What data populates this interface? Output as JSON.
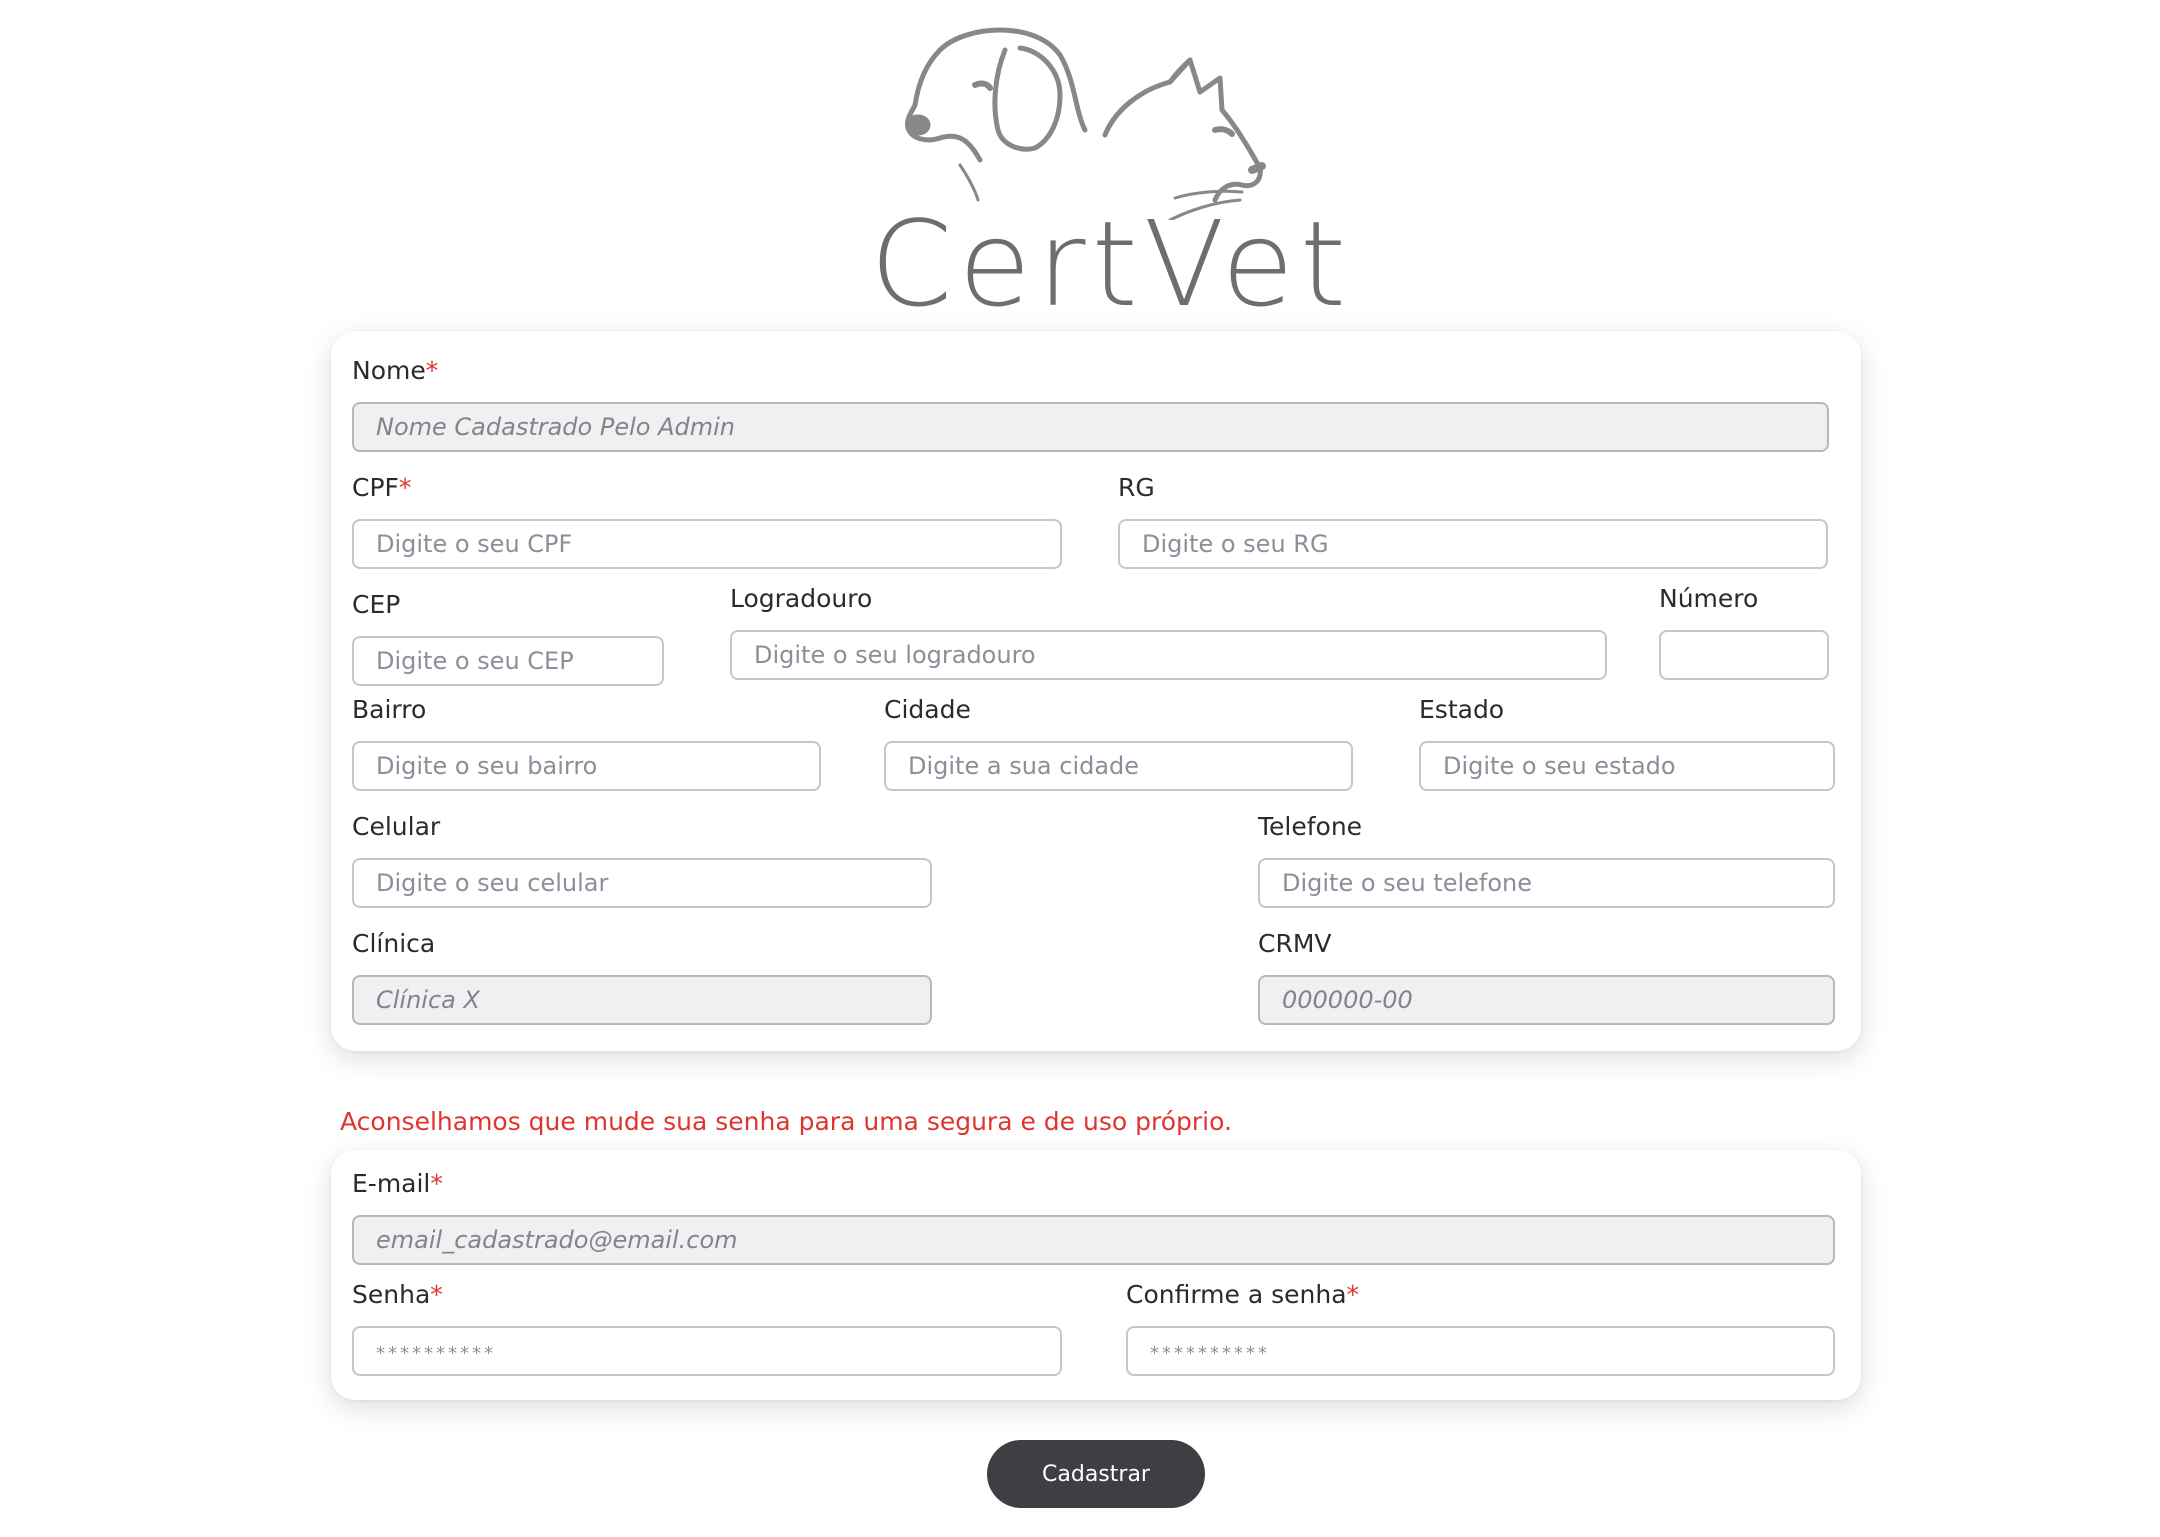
{
  "brand": {
    "name": "CertVet",
    "logo_icon": "dog-and-cat-logo-icon"
  },
  "profile": {
    "nome": {
      "label": "Nome",
      "required": "*",
      "placeholder": "Nome Cadastrado Pelo Admin"
    },
    "cpf": {
      "label": "CPF",
      "required": "*",
      "placeholder": "Digite o seu CPF"
    },
    "rg": {
      "label": "RG",
      "placeholder": "Digite o seu RG"
    },
    "cep": {
      "label": "CEP",
      "placeholder": "Digite o seu CEP"
    },
    "logradouro": {
      "label": "Logradouro",
      "placeholder": "Digite o seu logradouro"
    },
    "numero": {
      "label": "Número",
      "placeholder": ""
    },
    "bairro": {
      "label": "Bairro",
      "placeholder": "Digite o seu bairro"
    },
    "cidade": {
      "label": "Cidade",
      "placeholder": "Digite a sua cidade"
    },
    "estado": {
      "label": "Estado",
      "placeholder": "Digite o seu estado"
    },
    "celular": {
      "label": "Celular",
      "placeholder": "Digite o seu celular"
    },
    "telefone": {
      "label": "Telefone",
      "placeholder": "Digite o seu telefone"
    },
    "clinica": {
      "label": "Clínica",
      "placeholder": "Clínica X"
    },
    "crmv": {
      "label": "CRMV",
      "placeholder": "000000-00"
    }
  },
  "advice": "Aconselhamos que mude sua senha para uma segura e de uso próprio.",
  "account": {
    "email": {
      "label": "E-mail",
      "required": "*",
      "placeholder": "email_cadastrado@email.com"
    },
    "senha": {
      "label": "Senha",
      "required": "*",
      "placeholder": "**********"
    },
    "confirm": {
      "label": "Confirme a senha",
      "required": "*",
      "placeholder": "**********"
    }
  },
  "submit_label": "Cadastrar",
  "colors": {
    "accent_required": "#e0352f",
    "button_bg": "#3d3f42",
    "logo": "#6e6e6e"
  }
}
